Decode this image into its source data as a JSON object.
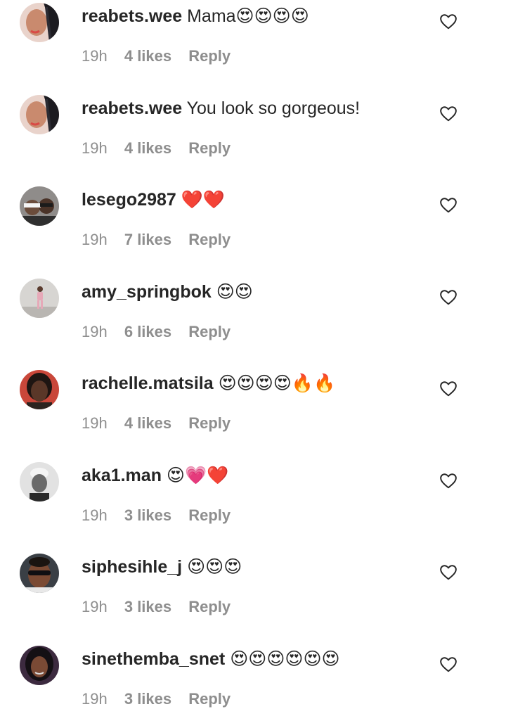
{
  "comments": [
    {
      "username": "reabets.wee",
      "text": "Mama😍😍😍😍",
      "time": "19h",
      "likes": "4 likes",
      "reply": "Reply",
      "avatar_icon": "profile-photo-braids"
    },
    {
      "username": "reabets.wee",
      "text": "You look so gorgeous!",
      "time": "19h",
      "likes": "4 likes",
      "reply": "Reply",
      "avatar_icon": "profile-photo-braids"
    },
    {
      "username": "lesego2987",
      "text": "❤️❤️",
      "time": "19h",
      "likes": "7 likes",
      "reply": "Reply",
      "avatar_icon": "profile-photo-couple"
    },
    {
      "username": "amy_springbok",
      "text": "😍😍",
      "time": "19h",
      "likes": "6 likes",
      "reply": "Reply",
      "avatar_icon": "profile-photo-standing"
    },
    {
      "username": "rachelle.matsila",
      "text": "😍😍😍😍🔥🔥",
      "time": "19h",
      "likes": "4 likes",
      "reply": "Reply",
      "avatar_icon": "profile-photo-portrait"
    },
    {
      "username": "aka1.man",
      "text": "😍💗❤️",
      "time": "19h",
      "likes": "3 likes",
      "reply": "Reply",
      "avatar_icon": "profile-photo-bw"
    },
    {
      "username": "siphesihle_j",
      "text": "😍😍😍",
      "time": "19h",
      "likes": "3 likes",
      "reply": "Reply",
      "avatar_icon": "profile-photo-sunglasses"
    },
    {
      "username": "sinethemba_snet",
      "text": "😍😍😍😍😍😍",
      "time": "19h",
      "likes": "3 likes",
      "reply": "Reply",
      "avatar_icon": "profile-photo-selfie"
    }
  ],
  "like_icon": "heart-outline-icon",
  "colors": {
    "username": "#262626",
    "meta": "#8e8e8e",
    "background": "#ffffff"
  }
}
